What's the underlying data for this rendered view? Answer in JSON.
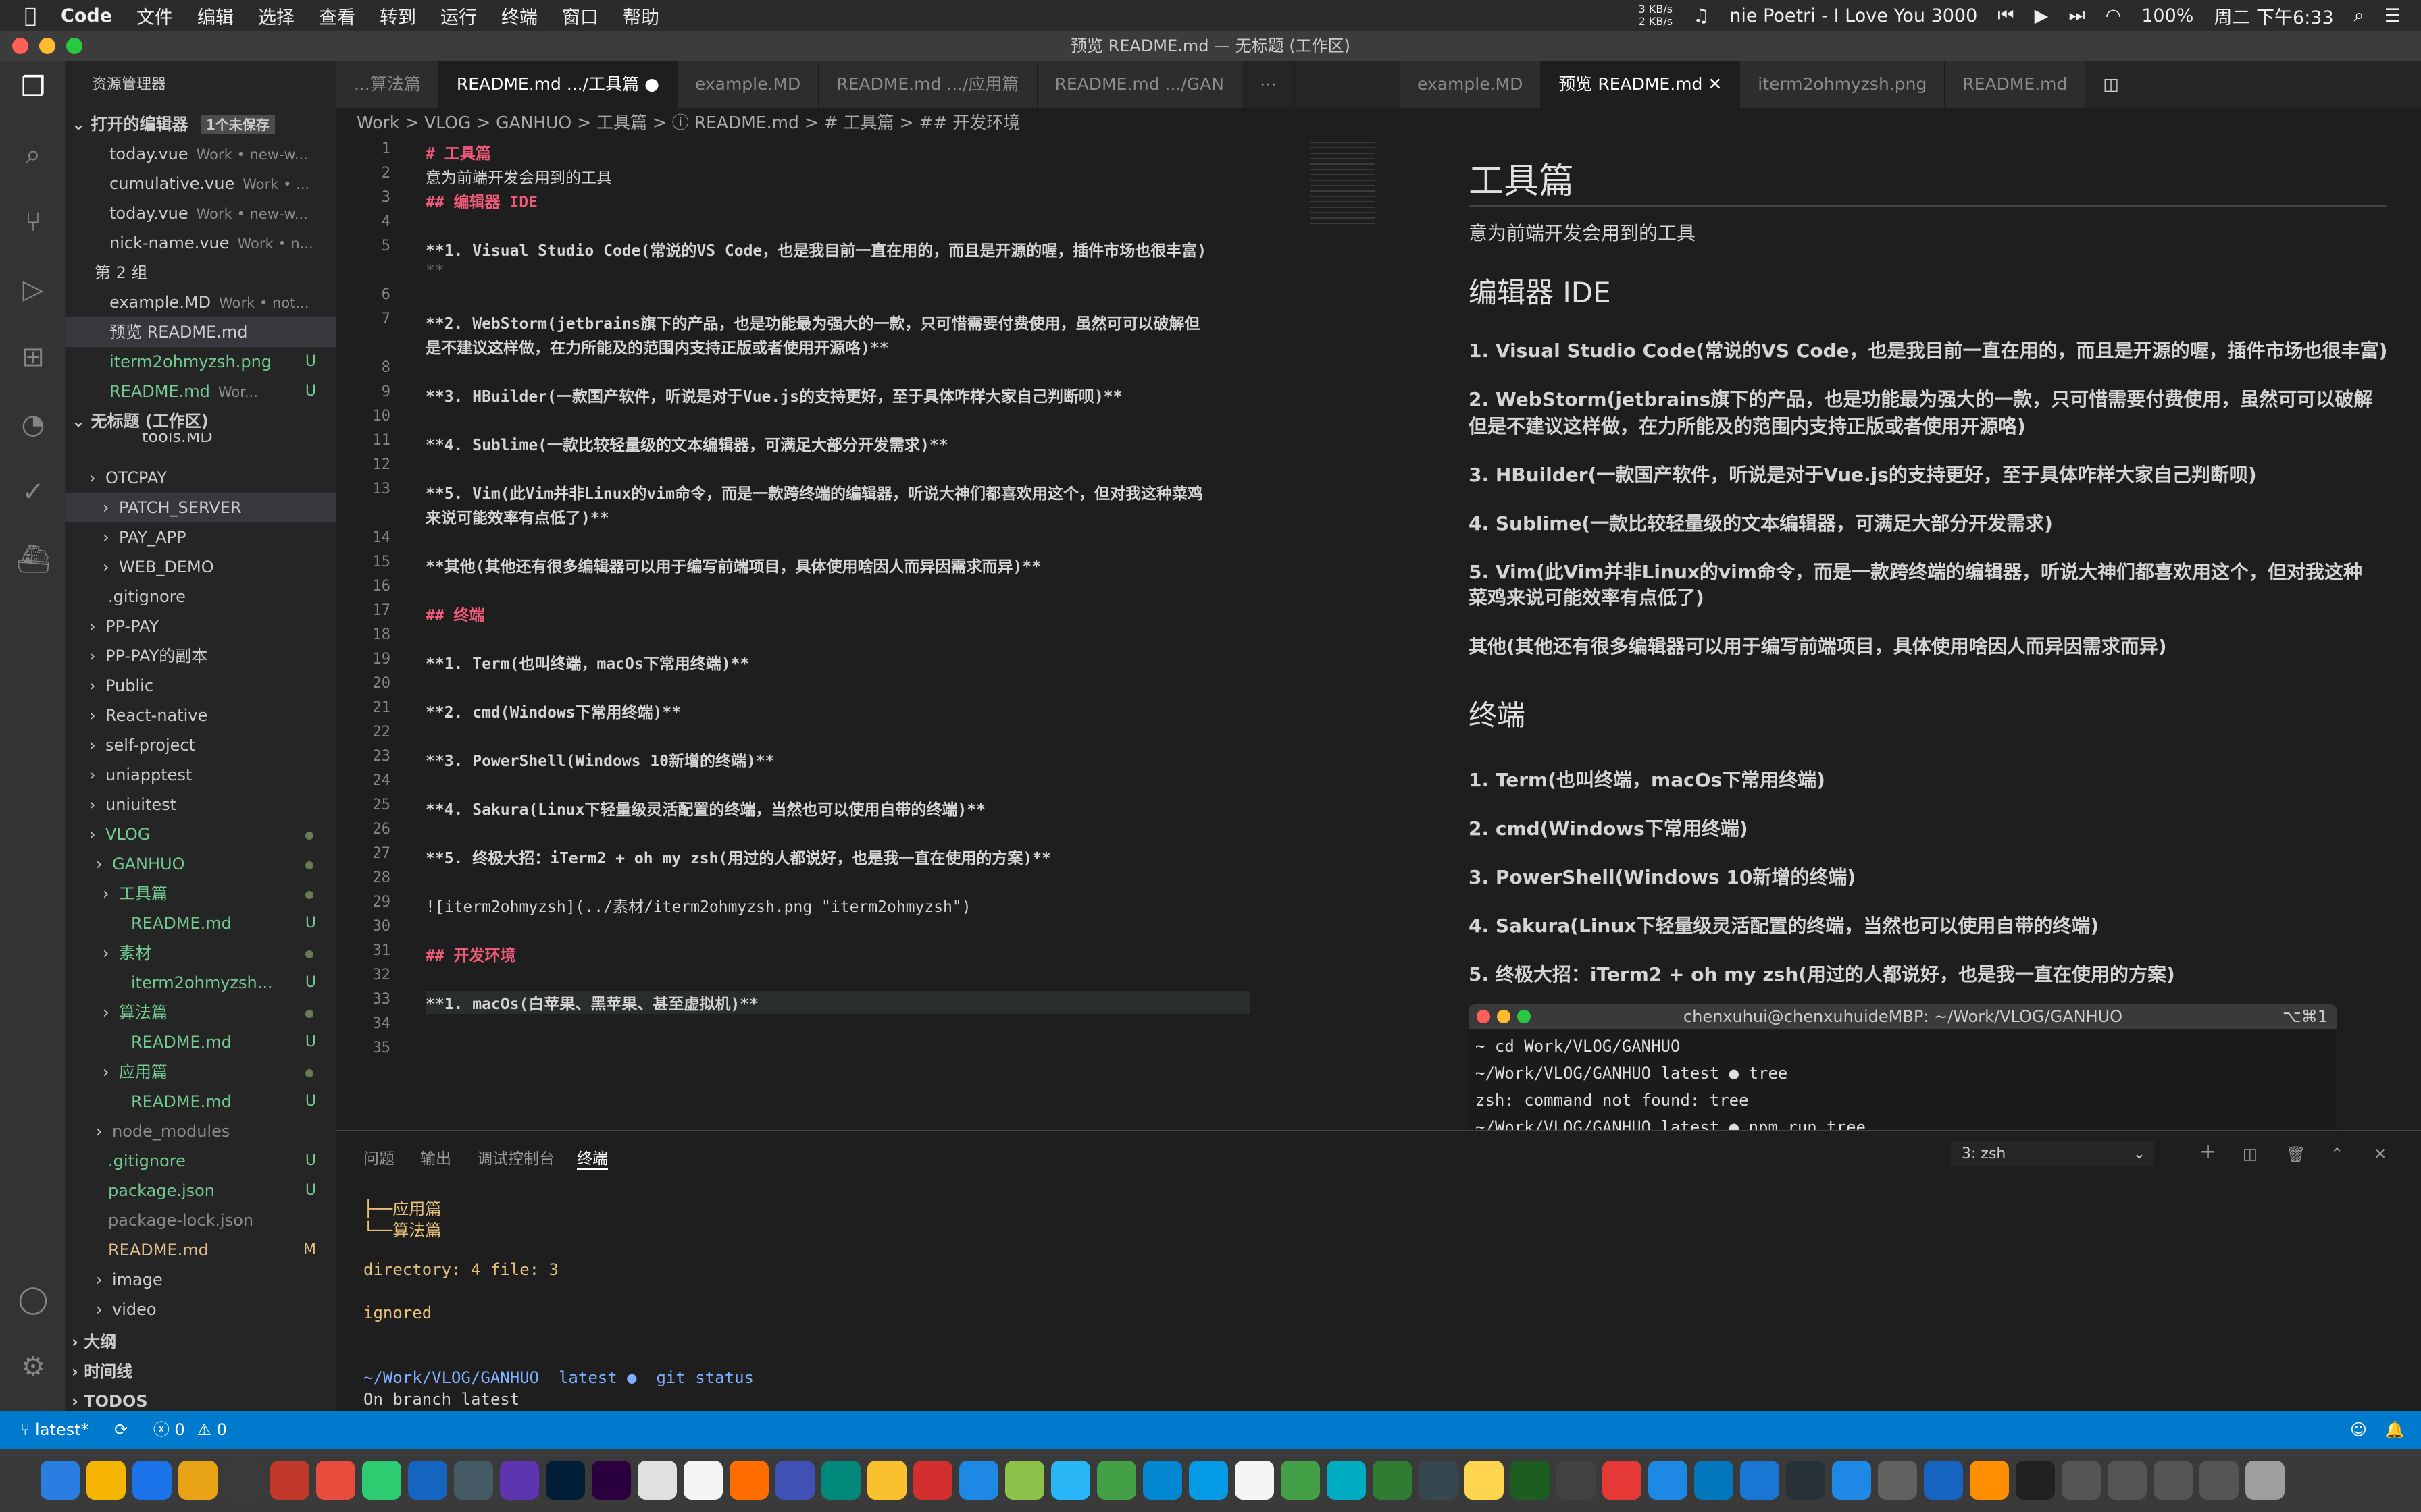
{
  "menubar": {
    "apple": "",
    "app": "Code",
    "items": [
      "文件",
      "编辑",
      "选择",
      "查看",
      "转到",
      "运行",
      "终端",
      "窗口",
      "帮助"
    ],
    "net": "3 KB/s\n2 KB/s",
    "song": "nie Poetri - I Love You 3000",
    "battery": "100%",
    "clock": "周二 下午6:33"
  },
  "window": {
    "title": "预览 README.md — 无标题 (工作区)"
  },
  "sidebar": {
    "title": "资源管理器",
    "open_editors": "打开的编辑器",
    "unsaved": "1个未保存",
    "open_items": [
      {
        "name": "today.vue",
        "desc": "Work • new-w..."
      },
      {
        "name": "cumulative.vue",
        "desc": "Work • ..."
      },
      {
        "name": "today.vue",
        "desc": "Work • new-w..."
      },
      {
        "name": "nick-name.vue",
        "desc": "Work • n..."
      },
      {
        "name": "第 2 组",
        "desc": ""
      },
      {
        "name": "example.MD",
        "desc": "Work • not..."
      },
      {
        "name": "预览 README.md",
        "desc": ""
      },
      {
        "name": "iterm2ohmyzsh.png",
        "desc": "",
        "badge": "U"
      },
      {
        "name": "README.md",
        "desc": "Wor...",
        "badge": "U"
      }
    ],
    "workspace": "无标题 (工作区)",
    "tree": [
      "tools.MD",
      "OTCPAY",
      "PATCH_SERVER",
      "PAY_APP",
      "WEB_DEMO",
      ".gitignore",
      "PP-PAY",
      "PP-PAY的副本",
      "Public",
      "React-native",
      "self-project",
      "uniapptest",
      "uniuitest",
      "VLOG",
      "GANHUO",
      "工具篇",
      "README.md",
      "素材",
      "iterm2ohmyzsh...",
      "算法篇",
      "README.md",
      "应用篇",
      "README.md",
      "node_modules",
      ".gitignore",
      "package.json",
      "package-lock.json",
      "README.md",
      "image",
      "video"
    ],
    "tree_badges": {
      "16": "U",
      "18": "U",
      "20": "U",
      "22": "U",
      "24": "U",
      "25": "U",
      "27": "M"
    },
    "outline": "大纲",
    "timeline": "时间线",
    "todos": "TODOS"
  },
  "tabs_left": [
    "...算法篇",
    "README.md .../工具篇",
    "example.MD",
    "README.md .../应用篇",
    "README.md .../GAN"
  ],
  "tabs_right": [
    "example.MD",
    "预览 README.md",
    "iterm2ohmyzsh.png",
    "README.md"
  ],
  "breadcrumb": "Work > VLOG > GANHUO > 工具篇 > ⓘ README.md > # 工具篇 > ## 开发环境",
  "editor": {
    "lines": [
      {
        "n": "1",
        "t": "# 工具篇",
        "k": "h"
      },
      {
        "n": "2",
        "t": "意为前端开发会用到的工具",
        "k": "p"
      },
      {
        "n": "3",
        "t": "## 编辑器 IDE",
        "k": "h"
      },
      {
        "n": "4",
        "t": "",
        "k": "p"
      },
      {
        "n": "5",
        "t": "**1. Visual Studio Code(常说的VS Code，也是我目前一直在用的，而且是开源的喔，插件市场也很丰富)",
        "k": "b"
      },
      {
        "n": "",
        "t": "**",
        "k": "m"
      },
      {
        "n": "6",
        "t": "",
        "k": "p"
      },
      {
        "n": "7",
        "t": "**2. WebStorm(jetbrains旗下的产品，也是功能最为强大的一款，只可惜需要付费使用，虽然可可以破解但",
        "k": "b"
      },
      {
        "n": "",
        "t": "是不建议这样做，在力所能及的范围内支持正版或者使用开源咯)**",
        "k": "b"
      },
      {
        "n": "8",
        "t": "",
        "k": "p"
      },
      {
        "n": "9",
        "t": "**3. HBuilder(一款国产软件，听说是对于Vue.js的支持更好，至于具体咋样大家自己判断呗)**",
        "k": "b"
      },
      {
        "n": "10",
        "t": "",
        "k": "p"
      },
      {
        "n": "11",
        "t": "**4. Sublime(一款比较轻量级的文本编辑器，可满足大部分开发需求)**",
        "k": "b"
      },
      {
        "n": "12",
        "t": "",
        "k": "p"
      },
      {
        "n": "13",
        "t": "**5. Vim(此Vim并非Linux的vim命令，而是一款跨终端的编辑器，听说大神们都喜欢用这个，但对我这种菜鸡",
        "k": "b"
      },
      {
        "n": "",
        "t": "来说可能效率有点低了)**",
        "k": "b"
      },
      {
        "n": "14",
        "t": "",
        "k": "p"
      },
      {
        "n": "15",
        "t": "**其他(其他还有很多编辑器可以用于编写前端项目，具体使用啥因人而异因需求而异)**",
        "k": "b"
      },
      {
        "n": "16",
        "t": "",
        "k": "p"
      },
      {
        "n": "17",
        "t": "## 终端",
        "k": "h"
      },
      {
        "n": "18",
        "t": "",
        "k": "p"
      },
      {
        "n": "19",
        "t": "**1. Term(也叫终端，macOs下常用终端)**",
        "k": "b"
      },
      {
        "n": "20",
        "t": "",
        "k": "p"
      },
      {
        "n": "21",
        "t": "**2. cmd(Windows下常用终端)**",
        "k": "b"
      },
      {
        "n": "22",
        "t": "",
        "k": "p"
      },
      {
        "n": "23",
        "t": "**3. PowerShell(Windows 10新增的终端)**",
        "k": "b"
      },
      {
        "n": "24",
        "t": "",
        "k": "p"
      },
      {
        "n": "25",
        "t": "**4. Sakura(Linux下轻量级灵活配置的终端，当然也可以使用自带的终端)**",
        "k": "b"
      },
      {
        "n": "26",
        "t": "",
        "k": "p"
      },
      {
        "n": "27",
        "t": "**5. 终极大招：iTerm2 + oh my zsh(用过的人都说好，也是我一直在使用的方案)**",
        "k": "b"
      },
      {
        "n": "28",
        "t": "",
        "k": "p"
      },
      {
        "n": "29",
        "t": "![iterm2ohmyzsh](../素材/iterm2ohmyzsh.png \"iterm2ohmyzsh\")",
        "k": "p"
      },
      {
        "n": "30",
        "t": "",
        "k": "p"
      },
      {
        "n": "31",
        "t": "## 开发环境",
        "k": "h"
      },
      {
        "n": "32",
        "t": "",
        "k": "p"
      },
      {
        "n": "33",
        "t": "**1. macOs(白苹果、黑苹果、甚至虚拟机)**",
        "k": "b"
      },
      {
        "n": "34",
        "t": "",
        "k": "p"
      },
      {
        "n": "35",
        "t": "",
        "k": "p"
      }
    ]
  },
  "preview": {
    "h1": "工具篇",
    "p1": "意为前端开发会用到的工具",
    "h2a": "编辑器 IDE",
    "items_a": [
      "1. Visual Studio Code(常说的VS Code，也是我目前一直在用的，而且是开源的喔，插件市场也很丰富)",
      "2. WebStorm(jetbrains旗下的产品，也是功能最为强大的一款，只可惜需要付费使用，虽然可可以破解",
      "但是不建议这样做，在力所能及的范围内支持正版或者使用开源咯)",
      "3. HBuilder(一款国产软件，听说是对于Vue.js的支持更好，至于具体咋样大家自己判断呗)",
      "4. Sublime(一款比较轻量级的文本编辑器，可满足大部分开发需求)",
      "5. Vim(此Vim并非Linux的vim命令，而是一款跨终端的编辑器，听说大神们都喜欢用这个，但对我这种",
      "菜鸡来说可能效率有点低了)",
      "其他(其他还有很多编辑器可以用于编写前端项目，具体使用啥因人而异因需求而异)"
    ],
    "h2b": "终端",
    "items_b": [
      "1. Term(也叫终端，macOs下常用终端)",
      "2. cmd(Windows下常用终端)",
      "3. PowerShell(Windows 10新增的终端)",
      "4. Sakura(Linux下轻量级灵活配置的终端，当然也可以使用自带的终端)",
      "5. 终极大招：iTerm2 + oh my zsh(用过的人都说好，也是我一直在使用的方案)"
    ],
    "img_title": "chenxuhui@chenxuhuideMBP: ~/Work/VLOG/GANHUO",
    "img_shortcut": "⌥⌘1",
    "img_lines": [
      "~  cd Work/VLOG/GANHUO",
      "~/Work/VLOG/GANHUO  latest ●  tree",
      "zsh: command not found: tree",
      "~/Work/VLOG/GANHUO  latest ●  npm run tree"
    ]
  },
  "panel": {
    "tabs": [
      "问题",
      "输出",
      "调试控制台",
      "终端"
    ],
    "shell": "3: zsh",
    "lines": [
      "├──应用篇",
      "└──算法篇",
      "",
      "directory: 4 file: 3",
      "",
      "ignored",
      "",
      "",
      "~/Work/VLOG/GANHUO  latest ●  git status",
      "On branch latest"
    ]
  },
  "statusbar": {
    "branch": "latest*",
    "errors": "0",
    "warnings": "0"
  }
}
